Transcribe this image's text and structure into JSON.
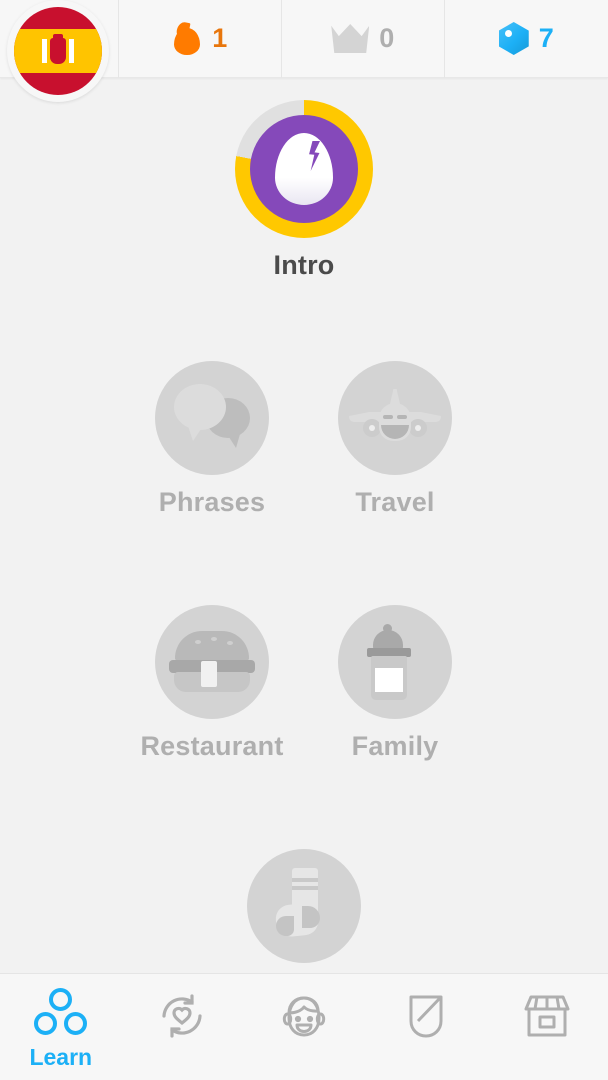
{
  "header": {
    "flag": {
      "icon": "spain-flag-icon",
      "language": "Spanish"
    },
    "stats": [
      {
        "icon": "flame-icon",
        "name": "streak",
        "value": "1",
        "color": "#e8760c"
      },
      {
        "icon": "crown-icon",
        "name": "crowns",
        "value": "0",
        "color": "#afafaf"
      },
      {
        "icon": "gem-icon",
        "name": "gems",
        "value": "7",
        "color": "#1cb0f6"
      }
    ]
  },
  "tree": {
    "skills": [
      {
        "label": "Intro",
        "icon": "egg-icon",
        "state": "active",
        "progress_percent": 78,
        "ring_color": "#ffc800",
        "ring_track": "#e0e0e0",
        "node_color": "#8549ba"
      },
      {
        "label": "Phrases",
        "icon": "speech-bubbles-icon",
        "state": "locked",
        "node_color": "#d3d3d3"
      },
      {
        "label": "Travel",
        "icon": "airplane-icon",
        "state": "locked",
        "node_color": "#d3d3d3"
      },
      {
        "label": "Restaurant",
        "icon": "burger-icon",
        "state": "locked",
        "node_color": "#d3d3d3"
      },
      {
        "label": "Family",
        "icon": "baby-bottle-icon",
        "state": "locked",
        "node_color": "#d3d3d3"
      },
      {
        "label": "",
        "icon": "sock-icon",
        "state": "locked",
        "node_color": "#d3d3d3"
      }
    ]
  },
  "nav": {
    "items": [
      {
        "label": "Learn",
        "icon": "learn-circles-icon",
        "active": true
      },
      {
        "label": "",
        "icon": "practice-refresh-heart-icon",
        "active": false
      },
      {
        "label": "",
        "icon": "profile-face-icon",
        "active": false
      },
      {
        "label": "",
        "icon": "shield-icon",
        "active": false
      },
      {
        "label": "",
        "icon": "shop-storefront-icon",
        "active": false
      }
    ],
    "active_color": "#1cb0f6",
    "inactive_color": "#afafaf"
  }
}
